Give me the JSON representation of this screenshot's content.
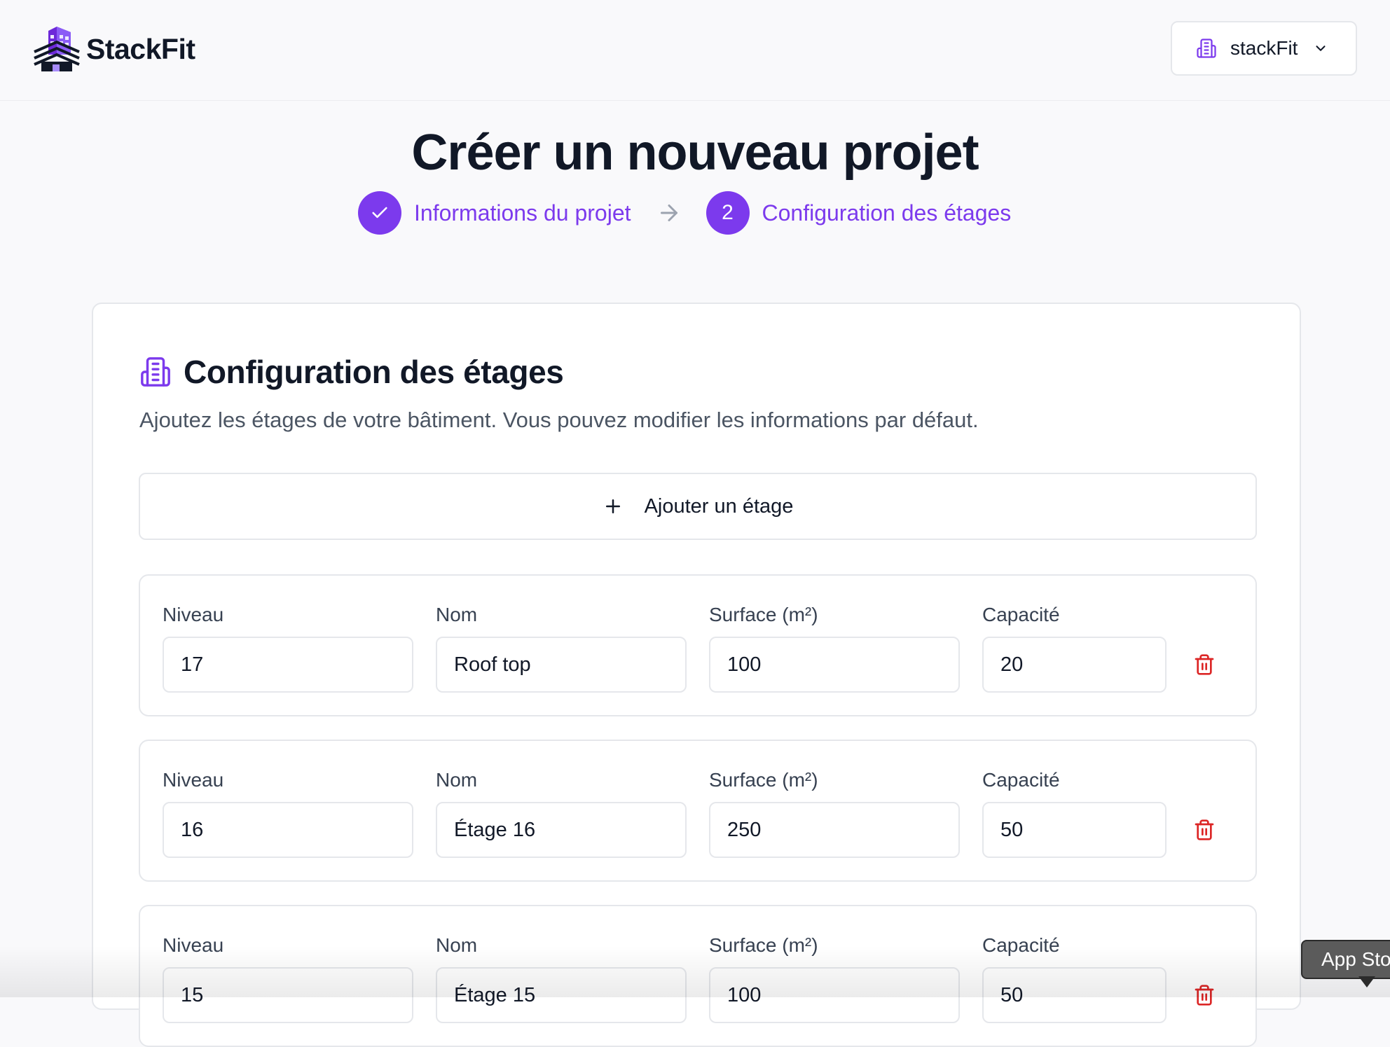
{
  "app": {
    "brand_name": "StackFit",
    "logo_icon": "building-logo-icon",
    "accent_color": "#7c3aed"
  },
  "header": {
    "org_switcher": {
      "label": "stackFit",
      "icon": "building-icon",
      "caret_icon": "chevron-down-icon"
    }
  },
  "page": {
    "title": "Créer un nouveau projet"
  },
  "stepper": {
    "steps": [
      {
        "label": "Informations du projet",
        "status": "completed",
        "marker": "check-icon"
      },
      {
        "label": "Configuration des étages",
        "status": "current",
        "number": "2"
      }
    ],
    "separator_icon": "arrow-right-icon"
  },
  "floors_card": {
    "title": "Configuration des étages",
    "subtitle": "Ajoutez les étages de votre bâtiment. Vous pouvez modifier les informations par défaut.",
    "add_button_label": "Ajouter un étage",
    "field_labels": {
      "level": "Niveau",
      "name": "Nom",
      "surface": "Surface (m²)",
      "capacity": "Capacité"
    },
    "delete_color": "#dc2626",
    "floors": [
      {
        "level": "17",
        "name": "Roof top",
        "surface": "100",
        "capacity": "20"
      },
      {
        "level": "16",
        "name": "Étage 16",
        "surface": "250",
        "capacity": "50"
      },
      {
        "level": "15",
        "name": "Étage 15",
        "surface": "100",
        "capacity": "50"
      }
    ]
  },
  "tooltip": {
    "text": "App Sto"
  }
}
